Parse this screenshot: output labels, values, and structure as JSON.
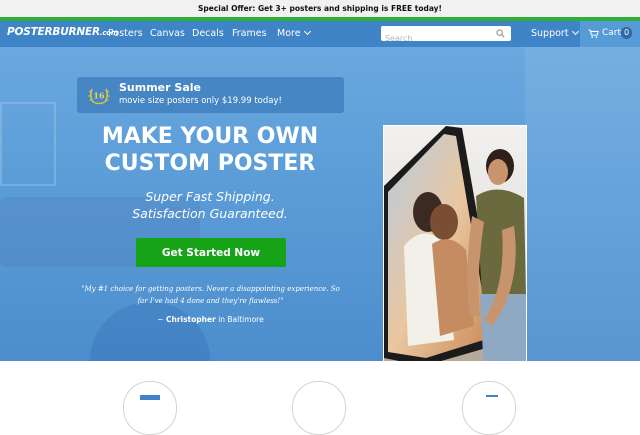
{
  "offer_bar": {
    "text": "Special Offer: Get 3+ posters and shipping is FREE today!"
  },
  "header": {
    "logo": {
      "main": "POSTERBURNER",
      "suffix": ".com"
    },
    "nav": [
      "Posters",
      "Canvas",
      "Decals",
      "Frames",
      "More"
    ],
    "search": {
      "placeholder": "Search",
      "value": ""
    },
    "support_label": "Support",
    "cart": {
      "label": "Cart",
      "count": "0"
    }
  },
  "hero": {
    "sale": {
      "badge_number": "16",
      "title": "Summer Sale",
      "subtitle": "movie size posters only $19.99 today!"
    },
    "headline": [
      "MAKE YOUR OWN",
      "CUSTOM POSTER"
    ],
    "subline": [
      "Super Fast Shipping.",
      "Satisfaction Guaranteed."
    ],
    "cta_label": "Get Started Now",
    "testimonial": {
      "quote": "\"My #1 choice for getting posters. Never a disappointing experience. So far I've had 4 done and they're flawless!\"",
      "author_prefix": "~",
      "author": "Christopher",
      "location": "in Baltimore"
    }
  },
  "colors": {
    "accent": "#3e84c6",
    "offer_stripe": "#2fae3a",
    "cta": "#17a317",
    "hero_bg": "#5b9cd8"
  },
  "icons": {
    "search": "search-icon",
    "cart": "cart-icon",
    "sale_badge": "laurel-badge-icon",
    "more_chevron": "chevron-down-icon",
    "support_chevron": "chevron-down-icon"
  }
}
